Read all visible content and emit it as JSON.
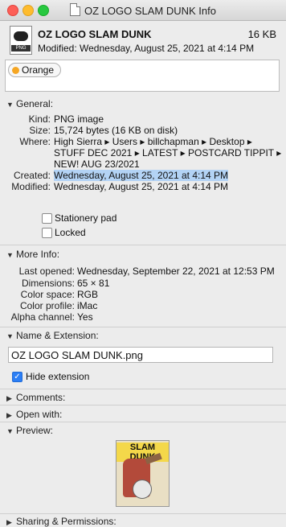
{
  "window": {
    "title": "OZ LOGO SLAM DUNK Info"
  },
  "header": {
    "name": "OZ LOGO SLAM DUNK",
    "size": "16 KB",
    "modified": "Modified: Wednesday, August 25, 2021 at 4:14 PM",
    "icon_label": "PNG"
  },
  "tags": [
    {
      "label": "Orange",
      "color": "#f5a623"
    }
  ],
  "general": {
    "heading": "General:",
    "kind_label": "Kind:",
    "kind": "PNG image",
    "size_label": "Size:",
    "size": "15,724 bytes (16 KB on disk)",
    "where_label": "Where:",
    "where_line1": "High Sierra ▸ Users ▸ billchapman ▸ Desktop ▸",
    "where_line2": "STUFF DEC 2021 ▸ LATEST ▸ POSTCARD TIPPIT ▸",
    "where_line3": "NEW! AUG 23/2021",
    "created_label": "Created:",
    "created": "Wednesday, August 25, 2021 at 4:14 PM",
    "modified_label": "Modified:",
    "modified": "Wednesday, August 25, 2021 at 4:14 PM",
    "stationery_label": "Stationery pad",
    "locked_label": "Locked"
  },
  "more_info": {
    "heading": "More Info:",
    "last_opened_label": "Last opened:",
    "last_opened": "Wednesday, September 22, 2021 at 12:53 PM",
    "dimensions_label": "Dimensions:",
    "dimensions": "65 × 81",
    "color_space_label": "Color space:",
    "color_space": "RGB",
    "color_profile_label": "Color profile:",
    "color_profile": "iMac",
    "alpha_label": "Alpha channel:",
    "alpha": "Yes"
  },
  "name_ext": {
    "heading": "Name & Extension:",
    "filename": "OZ LOGO SLAM DUNK.png",
    "hide_ext_label": "Hide extension",
    "hide_ext_checked": true
  },
  "comments": {
    "heading": "Comments:"
  },
  "open_with": {
    "heading": "Open with:"
  },
  "preview": {
    "heading": "Preview:",
    "image_text": "SLAM DUNK"
  },
  "sharing": {
    "heading": "Sharing & Permissions:"
  }
}
